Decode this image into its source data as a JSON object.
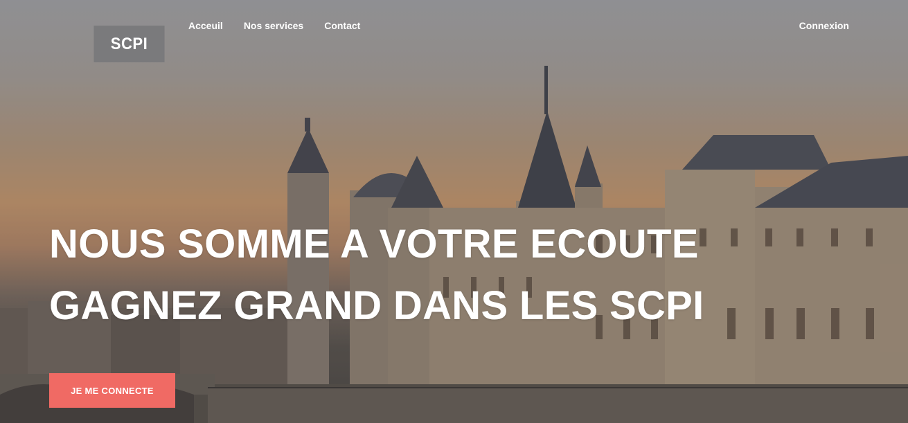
{
  "brand": {
    "logo_text": "SCPI"
  },
  "nav": {
    "items": [
      {
        "label": "Acceuil"
      },
      {
        "label": "Nos services"
      },
      {
        "label": "Contact"
      }
    ],
    "login_label": "Connexion"
  },
  "hero": {
    "headline_line1": "NOUS SOMME A VOTRE ECOUTE",
    "headline_line2": "GAGNEZ GRAND DANS LES SCPI",
    "cta_label": "JE ME CONNECTE"
  },
  "colors": {
    "accent": "#f06a64",
    "logo_bg": "#7a7a7c",
    "text": "#ffffff"
  }
}
